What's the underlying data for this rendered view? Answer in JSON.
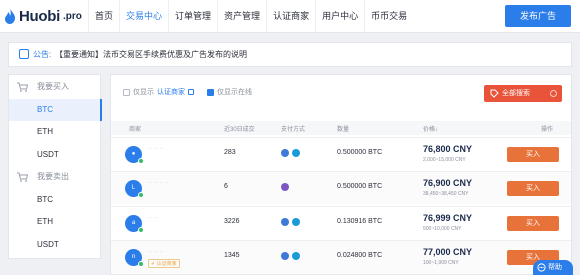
{
  "brand": {
    "name": "Huobi",
    "suffix": ".pro"
  },
  "nav": {
    "items": [
      "首页",
      "交易中心",
      "订单管理",
      "资产管理",
      "认证商家",
      "用户中心",
      "币币交易"
    ],
    "active_index": 1
  },
  "post_button": "发布广告",
  "notice": {
    "label": "公告:",
    "text": "【重要通知】法币交易区手续费优惠及广告发布的说明"
  },
  "sidebar": {
    "buy_heading": "我要买入",
    "buy_items": [
      "BTC",
      "ETH",
      "USDT"
    ],
    "sell_heading": "我要卖出",
    "sell_items": [
      "BTC",
      "ETH",
      "USDT"
    ],
    "active": "buy.BTC"
  },
  "filters": {
    "only_show": "仅显示",
    "certified_link": "认证商家",
    "online_label": "仅显示在线",
    "certified_checked": false,
    "online_checked": true
  },
  "all_search_button": "全部搜索",
  "table": {
    "headers": [
      "商家",
      "近30日成交",
      "支付方式",
      "数量",
      "价格↓",
      "操作"
    ],
    "rows": [
      {
        "avatar": "●",
        "merchant": "·  ·  ·",
        "tag": "",
        "deals": "283",
        "qty": "0.500000 BTC",
        "price": "76,800 CNY",
        "limit": "2,000~15,000 CNY",
        "action": "买入"
      },
      {
        "avatar": "L",
        "merchant": "· ·  · ·",
        "tag": "",
        "deals": "6",
        "qty": "0.500000 BTC",
        "price": "76,900 CNY",
        "limit": "38,450~38,450 CNY",
        "action": "买入"
      },
      {
        "avatar": "a",
        "merchant": "· ·",
        "tag": "",
        "deals": "3226",
        "qty": "0.130916 BTC",
        "price": "76,999 CNY",
        "limit": "500~10,000 CNY",
        "action": "买入"
      },
      {
        "avatar": "n",
        "merchant": "· ·  ·",
        "tag": "✔ 认证商家",
        "deals": "1345",
        "qty": "0.024800 BTC",
        "price": "77,000 CNY",
        "limit": "100~1,909 CNY",
        "action": "买入"
      }
    ]
  },
  "help_button": "帮助",
  "colors": {
    "accent": "#2b7de9",
    "buy": "#e8733a",
    "search": "#e8533a"
  }
}
